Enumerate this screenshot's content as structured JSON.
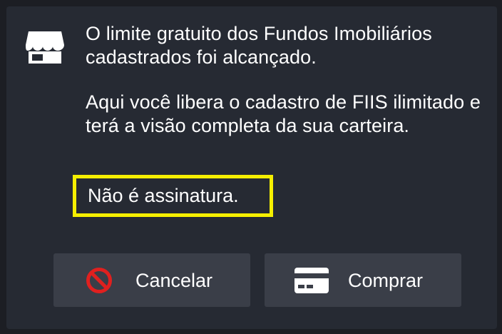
{
  "message": {
    "paragraph1": "O limite gratuito dos Fundos Imobiliários cadastrados foi alcançado.",
    "paragraph2": "Aqui você libera o cadastro de FIIS ilimitado e terá a visão completa da sua carteira.",
    "highlight": "Não é assinatura."
  },
  "buttons": {
    "cancel_label": "Cancelar",
    "buy_label": "Comprar"
  },
  "icons": {
    "header": "store-icon",
    "cancel": "prohibited-icon",
    "buy": "credit-card-icon"
  },
  "colors": {
    "background": "#262a33",
    "button": "#3a3e48",
    "highlight_border": "#f5ef00",
    "cancel_icon": "#e0201f",
    "text": "#ffffff"
  }
}
